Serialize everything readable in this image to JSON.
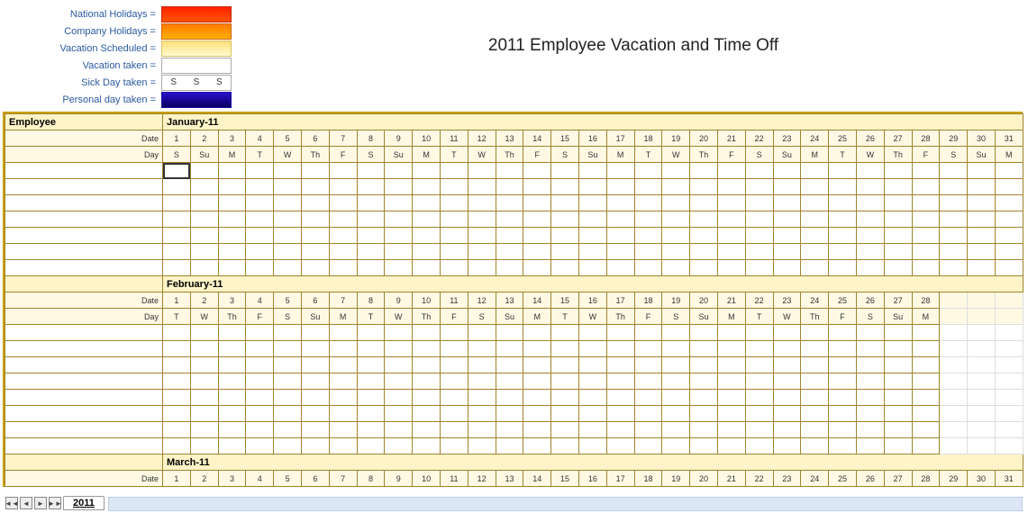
{
  "title": "2011 Employee Vacation and Time Off",
  "legend": {
    "national": "National Holidays =",
    "company": "Company Holidays =",
    "vacsched": "Vacation Scheduled =",
    "vactaken": "Vacation taken =",
    "sick": "Sick Day taken =",
    "personal": "Personal day taken =",
    "sick_marks": [
      "S",
      "S",
      "S"
    ]
  },
  "labels": {
    "employee": "Employee",
    "date": "Date",
    "day": "Day"
  },
  "months": [
    {
      "name": "January-11",
      "dates": [
        "1",
        "2",
        "3",
        "4",
        "5",
        "6",
        "7",
        "8",
        "9",
        "10",
        "11",
        "12",
        "13",
        "14",
        "15",
        "16",
        "17",
        "18",
        "19",
        "20",
        "21",
        "22",
        "23",
        "24",
        "25",
        "26",
        "27",
        "28",
        "29",
        "30",
        "31"
      ],
      "days": [
        "S",
        "Su",
        "M",
        "T",
        "W",
        "Th",
        "F",
        "S",
        "Su",
        "M",
        "T",
        "W",
        "Th",
        "F",
        "S",
        "Su",
        "M",
        "T",
        "W",
        "Th",
        "F",
        "S",
        "Su",
        "M",
        "T",
        "W",
        "Th",
        "F",
        "S",
        "Su",
        "M"
      ],
      "body_rows": 7,
      "show_employee_header": true
    },
    {
      "name": "February-11",
      "dates": [
        "1",
        "2",
        "3",
        "4",
        "5",
        "6",
        "7",
        "8",
        "9",
        "10",
        "11",
        "12",
        "13",
        "14",
        "15",
        "16",
        "17",
        "18",
        "19",
        "20",
        "21",
        "22",
        "23",
        "24",
        "25",
        "26",
        "27",
        "28"
      ],
      "days": [
        "T",
        "W",
        "Th",
        "F",
        "S",
        "Su",
        "M",
        "T",
        "W",
        "Th",
        "F",
        "S",
        "Su",
        "M",
        "T",
        "W",
        "Th",
        "F",
        "S",
        "Su",
        "M",
        "T",
        "W",
        "Th",
        "F",
        "S",
        "Su",
        "M"
      ],
      "body_rows": 8,
      "show_employee_header": false
    },
    {
      "name": "March-11",
      "dates": [
        "1",
        "2",
        "3",
        "4",
        "5",
        "6",
        "7",
        "8",
        "9",
        "10",
        "11",
        "12",
        "13",
        "14",
        "15",
        "16",
        "17",
        "18",
        "19",
        "20",
        "21",
        "22",
        "23",
        "24",
        "25",
        "26",
        "27",
        "28",
        "29",
        "30",
        "31"
      ],
      "days": [],
      "body_rows": 0,
      "show_employee_header": false
    }
  ],
  "tab": {
    "name": "2011"
  }
}
